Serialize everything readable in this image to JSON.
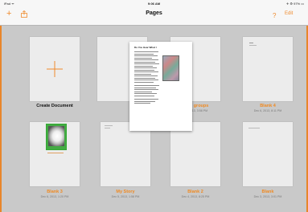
{
  "status_bar": {
    "left": "iPad ᯤ",
    "time": "9:06 AM",
    "right": "✈ ⚙ 97% ▭"
  },
  "nav_bar": {
    "title": "Pages",
    "help_label": "?",
    "edit_label": "Edit",
    "add_icon": "plus-icon",
    "share_icon": "share-icon"
  },
  "accent_color": "#ef8a2c",
  "documents": [
    {
      "title": "Create Document",
      "date": ""
    },
    {
      "title": "",
      "date": ""
    },
    {
      "title": "...n 3 groups",
      "date": "...3, 2013, 3:58 PM"
    },
    {
      "title": "Blank 4",
      "date": "Dec 6, 2013, 8:11 PM"
    },
    {
      "title": "Blank 3",
      "date": "Dec 6, 2013, 1:20 PM"
    },
    {
      "title": "My Story",
      "date": "Dec 5, 2013, 1:58 PM"
    },
    {
      "title": "Blank 2",
      "date": "Dec 4, 2013, 8:25 PM"
    },
    {
      "title": "Blank",
      "date": "Dec 3, 2013, 3:01 PM"
    }
  ],
  "popup": {
    "title": "Do You Hear What I"
  }
}
